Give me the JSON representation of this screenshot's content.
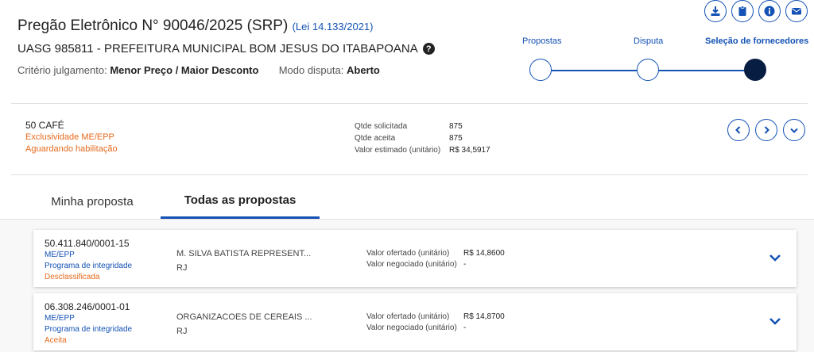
{
  "header": {
    "title": "Pregão Eletrônico N° 90046/2025 (SRP)",
    "lei_link": "(Lei 14.133/2021)",
    "uasg": "UASG 985811 - PREFEITURA MUNICIPAL BOM JESUS DO ITABAPOANA",
    "criterio_label": "Critério julgamento:",
    "criterio_value": "Menor Preço / Maior Desconto",
    "modo_label": "Modo disputa:",
    "modo_value": "Aberto"
  },
  "action_icons": [
    "download-icon",
    "clipboard-icon",
    "info-icon",
    "mail-icon"
  ],
  "steps": [
    {
      "label": "Propostas",
      "state": "done"
    },
    {
      "label": "Disputa",
      "state": "done"
    },
    {
      "label": "Seleção de fornecedores",
      "state": "current"
    }
  ],
  "item": {
    "name": "50  CAFÉ",
    "exclusividade": "Exclusividade ME/EPP",
    "status": "Aguardando habilitação",
    "qtde_solicitada_label": "Qtde solicitada",
    "qtde_solicitada_value": "875",
    "qtde_aceita_label": "Qtde aceita",
    "qtde_aceita_value": "875",
    "valor_estimado_label": "Valor estimado (unitário)",
    "valor_estimado_value": "R$ 34,5917"
  },
  "tabs": [
    {
      "label": "Minha proposta",
      "active": false
    },
    {
      "label": "Todas as propostas",
      "active": true
    }
  ],
  "proposals": [
    {
      "cnpj": "50.411.840/0001-15",
      "porte": "ME/EPP",
      "programa": "Programa de integridade",
      "status": "Desclassificada",
      "nome": "M. SILVA BATISTA REPRESENT...",
      "uf": "RJ",
      "valor_ofertado_label": "Valor ofertado (unitário)",
      "valor_ofertado": "R$ 14,8600",
      "valor_negociado_label": "Valor negociado (unitário)",
      "valor_negociado": "-"
    },
    {
      "cnpj": "06.308.246/0001-01",
      "porte": "ME/EPP",
      "programa": "Programa de integridade",
      "status": "Aceita",
      "nome": "ORGANIZACOES DE CEREAIS ...",
      "uf": "RJ",
      "valor_ofertado_label": "Valor ofertado (unitário)",
      "valor_ofertado": "R$ 14,8700",
      "valor_negociado_label": "Valor negociado (unitário)",
      "valor_negociado": "-"
    }
  ],
  "colors": {
    "primary": "#1351b4",
    "dark": "#071d41",
    "warning": "#e56a1c"
  }
}
